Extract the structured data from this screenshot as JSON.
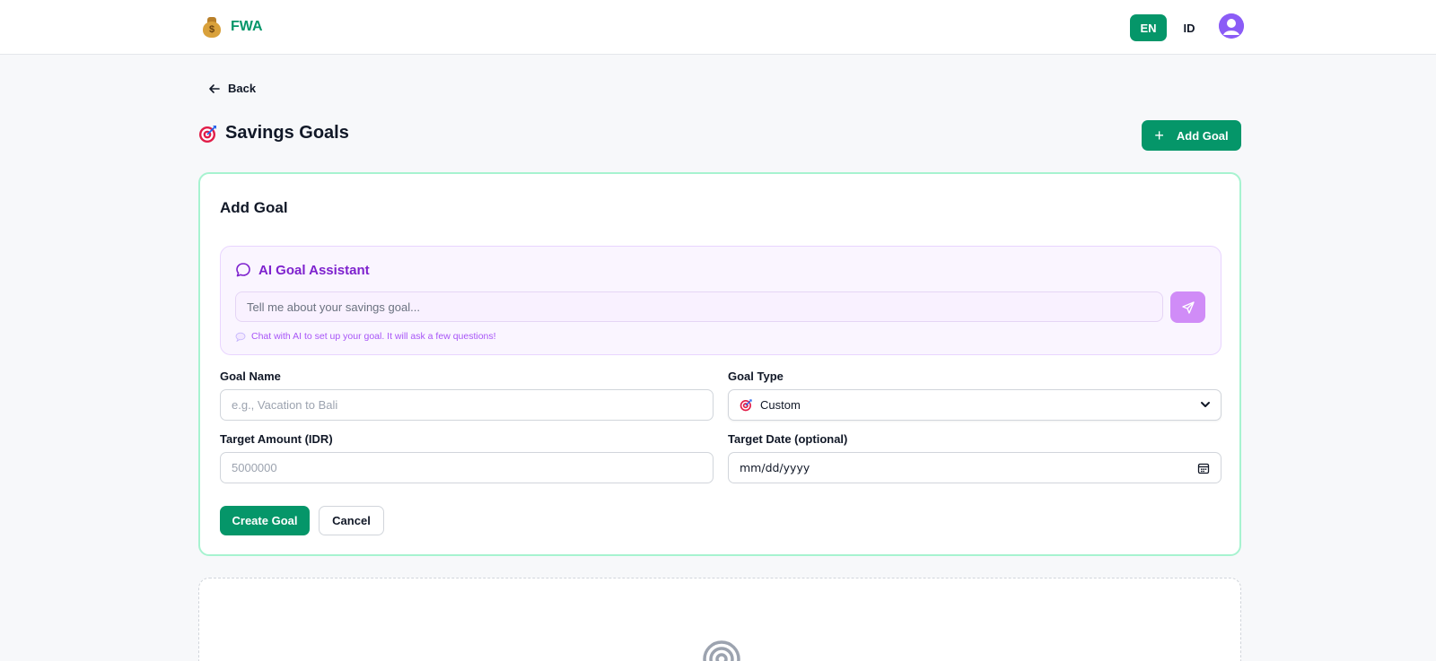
{
  "header": {
    "brand_name": "FWA",
    "brand_icon": "money-bag-icon",
    "languages": [
      "EN",
      "ID"
    ],
    "active_language": "EN",
    "avatar_icon": "user-avatar-icon",
    "accent_color": "#059669"
  },
  "nav": {
    "back_label": "Back"
  },
  "page": {
    "title": "Savings Goals",
    "title_icon": "target-icon",
    "add_goal_label": "Add Goal"
  },
  "form": {
    "title": "Add Goal",
    "ai_assistant": {
      "title": "AI Goal Assistant",
      "input_placeholder": "Tell me about your savings goal...",
      "hint_icon": "speech-bubble-icon",
      "hint": "Chat with AI to set up your goal. It will ask a few questions!",
      "accent_color": "#7e22ce"
    },
    "goal_name": {
      "label": "Goal Name",
      "placeholder": "e.g., Vacation to Bali"
    },
    "goal_type": {
      "label": "Goal Type",
      "selected": "Custom",
      "selected_icon": "target-icon"
    },
    "target_amount": {
      "label": "Target Amount (IDR)",
      "placeholder": "5000000"
    },
    "target_date": {
      "label": "Target Date (optional)",
      "placeholder": "mm/dd/yyyy"
    },
    "create_label": "Create Goal",
    "cancel_label": "Cancel"
  },
  "empty_state": {
    "icon": "target-rings-icon"
  }
}
